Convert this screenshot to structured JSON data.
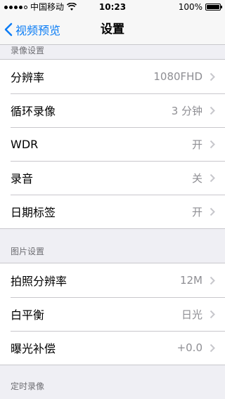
{
  "status": {
    "carrier": "中国移动",
    "time": "10:23",
    "battery": "100%"
  },
  "nav": {
    "back_label": "视频预览",
    "title": "设置"
  },
  "sections": [
    {
      "header": "录像设置",
      "items": [
        {
          "label": "分辨率",
          "value": "1080FHD"
        },
        {
          "label": "循环录像",
          "value": "3 分钟"
        },
        {
          "label": "WDR",
          "value": "开"
        },
        {
          "label": "录音",
          "value": "关"
        },
        {
          "label": "日期标签",
          "value": "开"
        }
      ]
    },
    {
      "header": "图片设置",
      "items": [
        {
          "label": "拍照分辨率",
          "value": "12M"
        },
        {
          "label": "白平衡",
          "value": "日光"
        },
        {
          "label": "曝光补偿",
          "value": "+0.0"
        }
      ]
    },
    {
      "header": "定时录像",
      "items": []
    }
  ],
  "colors": {
    "accent": "#0a7cf5",
    "background": "#efeff4",
    "separator": "#c8c7cc",
    "secondary_text": "#8e8e93"
  }
}
